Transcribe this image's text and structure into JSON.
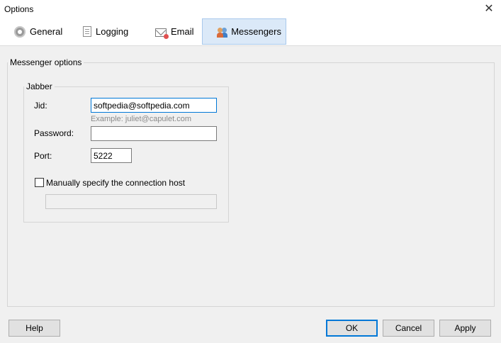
{
  "window": {
    "title": "Options",
    "close_glyph": "✕"
  },
  "tabs": [
    {
      "label": "General",
      "icon": "gear-icon",
      "active": false
    },
    {
      "label": "Logging",
      "icon": "document-icon",
      "active": false
    },
    {
      "label": "Email",
      "icon": "envelope-icon",
      "active": false
    },
    {
      "label": "Messengers",
      "icon": "people-icon",
      "active": true
    }
  ],
  "messenger_group": {
    "legend": "Messenger options",
    "jabber": {
      "legend": "Jabber",
      "jid_label": "Jid:",
      "jid_value": "softpedia@softpedia.com",
      "jid_hint": "Example: juliet@capulet.com",
      "password_label": "Password:",
      "password_value": "",
      "port_label": "Port:",
      "port_value": "5222",
      "manual_host_label": "Manually specify the connection host",
      "manual_host_checked": false,
      "host_value": ""
    }
  },
  "buttons": {
    "help": "Help",
    "ok": "OK",
    "cancel": "Cancel",
    "apply": "Apply"
  },
  "colors": {
    "accent": "#0078d7",
    "active_tab": "#dbe9f8"
  }
}
